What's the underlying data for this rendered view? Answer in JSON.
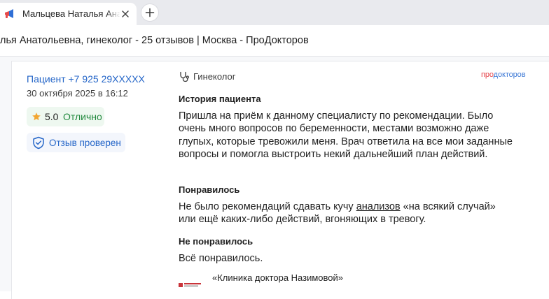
{
  "browser": {
    "tab_title": "Мальцева Наталья Анатольевна",
    "tab_icon": "megaphone-icon",
    "close_icon": "close-icon",
    "new_tab_icon": "plus-icon"
  },
  "page_title": "лья Анатольевна, гинеколог - 25 отзывов | Москва - ПроДокторов",
  "review": {
    "author": "Пациент +7 925 29XXXXX",
    "date": "30 октября 2025 в 16:12",
    "rating_value": "5.0",
    "rating_word": "Отлично",
    "verified_label": "Отзыв проверен",
    "specialty": "Гинеколог",
    "brand": {
      "part1": "про",
      "part2": "докторов",
      "color1": "#e5454b",
      "color2": "#3f7ad6"
    },
    "history_heading": "История пациента",
    "history_text": "Пришла на приём к данному специалисту по рекомендации. Было очень много вопросов по беременности, местами возможно даже глупых, которые тревожили меня. Врач ответила на все мои заданные вопросы и помогла выстроить некий дальнейший план действий.",
    "liked_heading": "Понравилось",
    "liked_before": "Не было рекомендаций сдавать кучу",
    "liked_link": "анализов",
    "liked_after": "«на всякий случай» или ещё каких-либо действий, вгоняющих в тревогу.",
    "disliked_heading": "Не понравилось",
    "disliked_text": "Всё понравилось.",
    "clinic_name": "«Клиника доктора Назимовой»"
  },
  "colors": {
    "link_blue": "#2566c8",
    "rating_green": "#238a3f",
    "star_orange": "#f2a531"
  }
}
